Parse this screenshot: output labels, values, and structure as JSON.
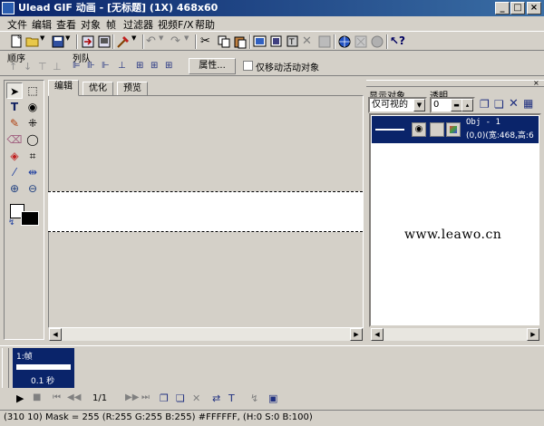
{
  "window": {
    "title": "Ulead GIF 动画 - [无标题] (1X) 468x60",
    "title_color": "#0a246a"
  },
  "menu": [
    "文件",
    "编辑",
    "查看",
    "对象",
    "帧",
    "过滤器",
    "视频F/X",
    "帮助"
  ],
  "arrange_bar": {
    "order_label": "顺序",
    "queue_label": "列队",
    "properties_button": "属性...",
    "move_active_only": "仅移动活动对象"
  },
  "editor": {
    "tabs": [
      "编辑",
      "优化",
      "预览"
    ],
    "active_tab": "编辑",
    "canvas_size": "468x60"
  },
  "object_manager": {
    "show_label": "显示对象",
    "opacity_label": "透明",
    "show_value": "仅可视的",
    "opacity_value": "0",
    "object_name": "Obj - 1",
    "object_info": "(0,0)(宽:468,高:6"
  },
  "watermark": "www.leawo.cn",
  "frames": {
    "frame_label": "1:帧",
    "frame_delay": "0.1 秒",
    "frame_counter": "1/1"
  },
  "status": "(310 10) Mask = 255 (R:255 G:255 B:255) #FFFFFF, (H:0 S:0 B:100)"
}
